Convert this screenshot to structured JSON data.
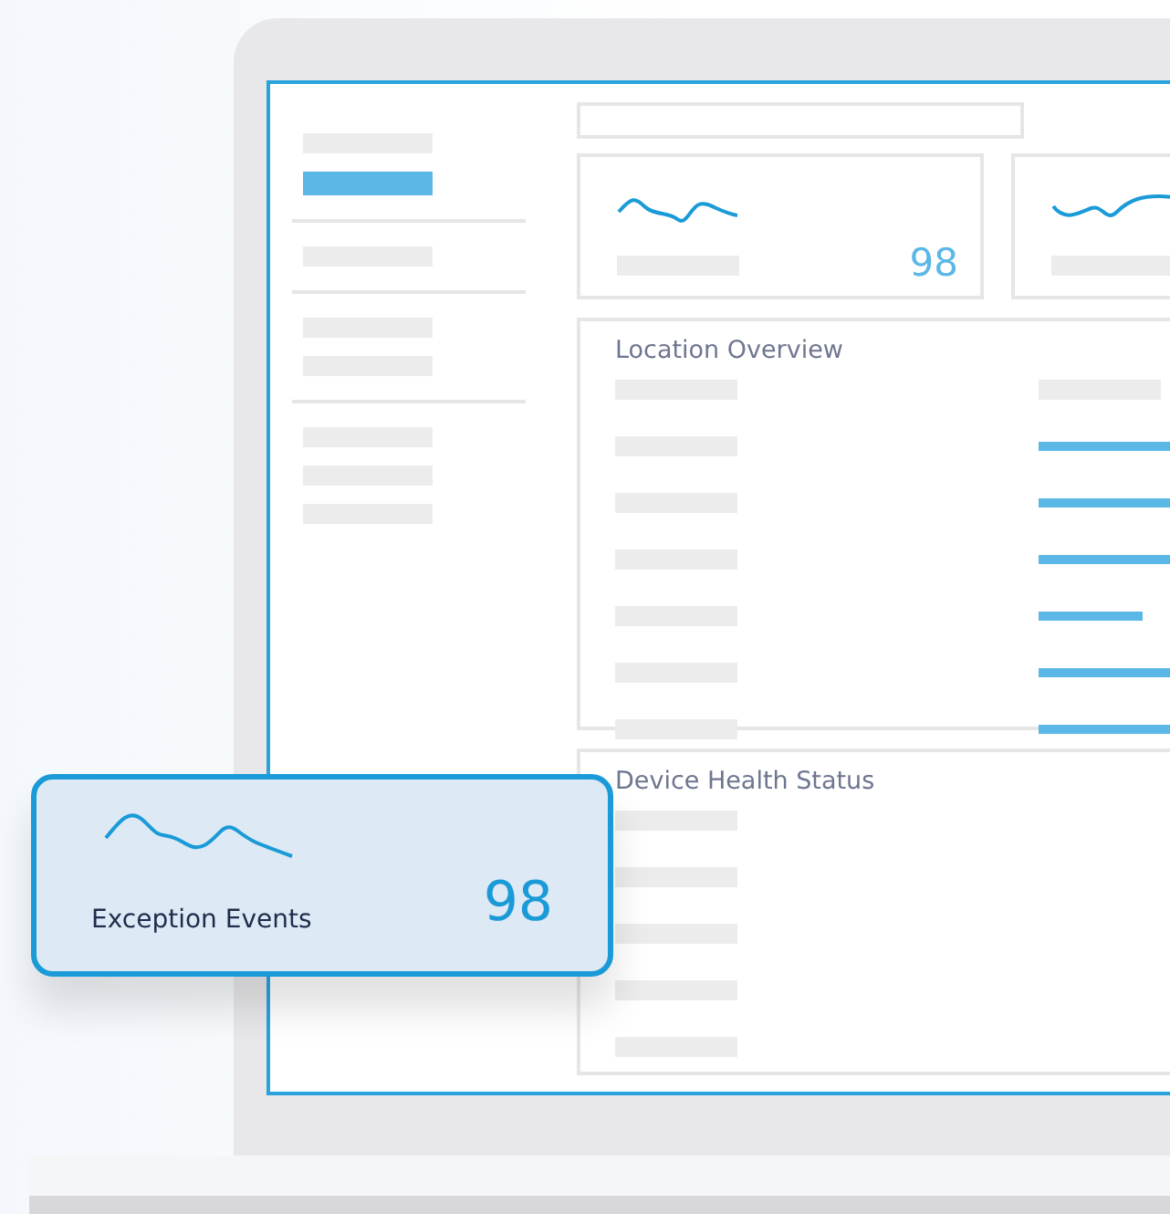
{
  "stat_cards": [
    {
      "value": "98"
    }
  ],
  "location_overview": {
    "title": "Location Overview"
  },
  "device_health": {
    "title": "Device Health Status"
  },
  "floating_card": {
    "label": "Exception Events",
    "value": "98"
  }
}
